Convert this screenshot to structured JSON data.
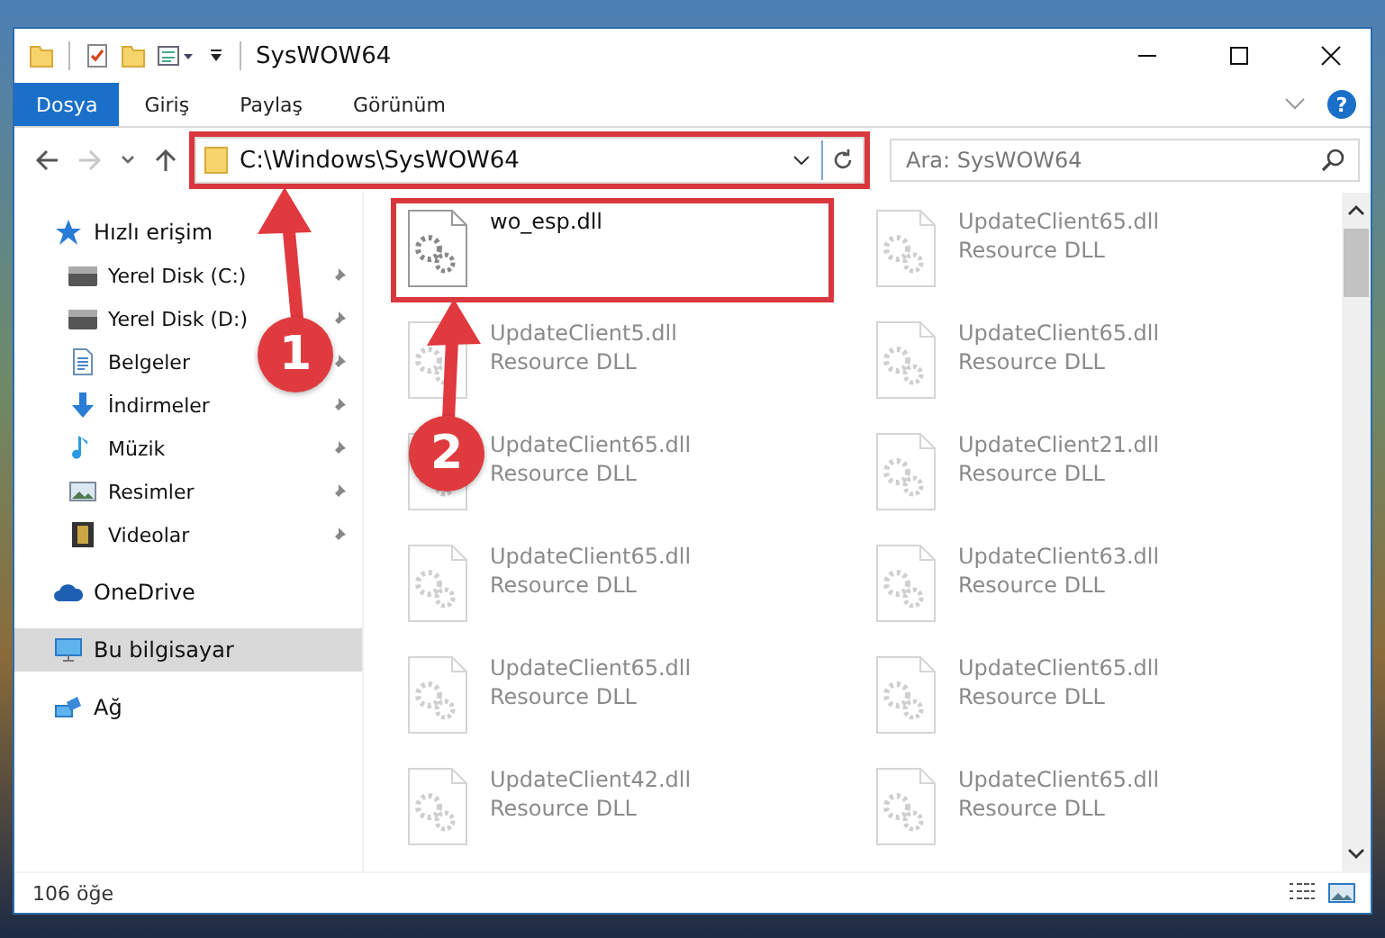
{
  "window": {
    "title": "SysWOW64"
  },
  "ribbon_tabs": [
    {
      "label": "Dosya",
      "selected": true
    },
    {
      "label": "Giriş",
      "selected": false
    },
    {
      "label": "Paylaş",
      "selected": false
    },
    {
      "label": "Görünüm",
      "selected": false
    }
  ],
  "help": "?",
  "navigation": {
    "forward_disabled": true
  },
  "address": {
    "value": "C:\\Windows\\SysWOW64",
    "highlighted": true
  },
  "search": {
    "placeholder": "Ara: SysWOW64"
  },
  "sidebar": {
    "items": [
      {
        "label": "Hızlı erişim",
        "kind": "star",
        "selected": false,
        "children": [
          {
            "label": "Yerel Disk (C:)",
            "kind": "drive",
            "pinned": true,
            "selected": false
          },
          {
            "label": "Yerel Disk (D:)",
            "kind": "drive",
            "pinned": true,
            "selected": false
          },
          {
            "label": "Belgeler",
            "kind": "document",
            "pinned": true,
            "selected": false
          },
          {
            "label": "İndirmeler",
            "kind": "download",
            "pinned": true,
            "selected": false
          },
          {
            "label": "Müzik",
            "kind": "music",
            "pinned": true,
            "selected": false
          },
          {
            "label": "Resimler",
            "kind": "pictures",
            "pinned": true,
            "selected": false
          },
          {
            "label": "Videolar",
            "kind": "video",
            "pinned": true,
            "selected": false
          }
        ]
      },
      {
        "label": "OneDrive",
        "kind": "cloud",
        "selected": false
      },
      {
        "label": "Bu bilgisayar",
        "kind": "computer",
        "selected": true
      },
      {
        "label": "Ağ",
        "kind": "network",
        "selected": false
      }
    ]
  },
  "files": [
    {
      "name": "wo_esp.dll",
      "dimmed": false,
      "highlighted": true
    },
    {
      "name": "UpdateClient65.dll",
      "type": "Resource DLL",
      "dimmed": true,
      "highlighted": false
    },
    {
      "name": "UpdateClient5.dll",
      "type": "Resource DLL",
      "dimmed": true,
      "highlighted": false
    },
    {
      "name": "UpdateClient65.dll",
      "type": "Resource DLL",
      "dimmed": true,
      "highlighted": false
    },
    {
      "name": "UpdateClient65.dll",
      "type": "Resource DLL",
      "dimmed": true,
      "highlighted": false
    },
    {
      "name": "UpdateClient21.dll",
      "type": "Resource DLL",
      "dimmed": true,
      "highlighted": false
    },
    {
      "name": "UpdateClient65.dll",
      "type": "Resource DLL",
      "dimmed": true,
      "highlighted": false
    },
    {
      "name": "UpdateClient63.dll",
      "type": "Resource DLL",
      "dimmed": true,
      "highlighted": false
    },
    {
      "name": "UpdateClient65.dll",
      "type": "Resource DLL",
      "dimmed": true,
      "highlighted": false
    },
    {
      "name": "UpdateClient65.dll",
      "type": "Resource DLL",
      "dimmed": true,
      "highlighted": false
    },
    {
      "name": "UpdateClient42.dll",
      "type": "Resource DLL",
      "dimmed": true,
      "highlighted": false
    },
    {
      "name": "UpdateClient65.dll",
      "type": "Resource DLL",
      "dimmed": true,
      "highlighted": false
    }
  ],
  "status_bar": {
    "count": "106 öğe"
  },
  "annotations": [
    {
      "label": "1"
    },
    {
      "label": "2"
    }
  ]
}
